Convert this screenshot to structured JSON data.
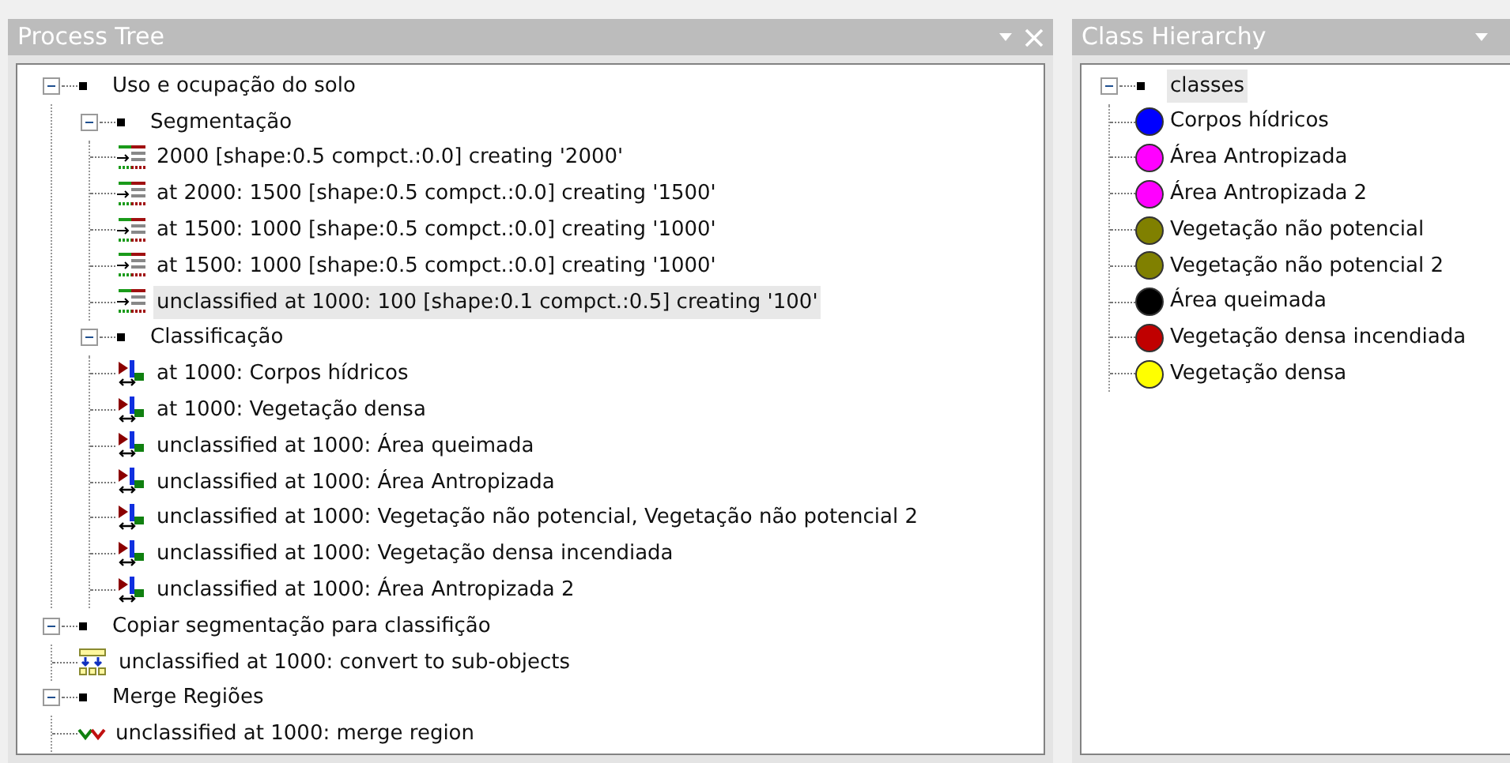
{
  "process_tree": {
    "title": "Process Tree",
    "items": [
      {
        "kind": "process",
        "label": "Uso e ocupação do solo",
        "expanded": true,
        "selected": false,
        "children": [
          {
            "kind": "process",
            "label": "Segmentação",
            "expanded": true,
            "selected": false,
            "children": [
              {
                "kind": "segmentation",
                "label": "2000 [shape:0.5 compct.:0.0] creating '2000'",
                "selected": false
              },
              {
                "kind": "segmentation",
                "label": "at  2000: 1500 [shape:0.5 compct.:0.0] creating '1500'",
                "selected": false
              },
              {
                "kind": "segmentation",
                "label": "at  1500: 1000 [shape:0.5 compct.:0.0] creating '1000'",
                "selected": false
              },
              {
                "kind": "segmentation",
                "label": "at  1500: 1000 [shape:0.5 compct.:0.0] creating '1000'",
                "selected": false
              },
              {
                "kind": "segmentation",
                "label": "unclassified at  1000: 100 [shape:0.1 compct.:0.5] creating '100'",
                "selected": true
              }
            ]
          },
          {
            "kind": "process",
            "label": "Classificação",
            "expanded": true,
            "selected": false,
            "children": [
              {
                "kind": "classification",
                "label": "at  1000: Corpos hídricos",
                "selected": false
              },
              {
                "kind": "classification",
                "label": "at  1000: Vegetação densa",
                "selected": false
              },
              {
                "kind": "classification",
                "label": "unclassified at  1000: Área queimada",
                "selected": false
              },
              {
                "kind": "classification",
                "label": "unclassified at  1000: Área Antropizada",
                "selected": false
              },
              {
                "kind": "classification",
                "label": "unclassified at  1000: Vegetação não potencial, Vegetação não potencial 2",
                "selected": false
              },
              {
                "kind": "classification",
                "label": "unclassified at  1000: Vegetação densa incendiada",
                "selected": false
              },
              {
                "kind": "classification",
                "label": "unclassified at  1000: Área Antropizada 2",
                "selected": false
              }
            ]
          }
        ]
      },
      {
        "kind": "process",
        "label": "Copiar segmentação para classifição",
        "expanded": true,
        "selected": false,
        "children": [
          {
            "kind": "convert",
            "label": "unclassified at  1000: convert to sub-objects",
            "selected": false
          }
        ]
      },
      {
        "kind": "process",
        "label": "Merge Regiões",
        "expanded": true,
        "selected": false,
        "children": [
          {
            "kind": "merge",
            "label": "unclassified at  1000: merge region",
            "selected": false
          }
        ]
      }
    ]
  },
  "class_hierarchy": {
    "title": "Class Hierarchy",
    "root": {
      "label": "classes",
      "expanded": true,
      "selected": true
    },
    "classes": [
      {
        "label": "Corpos hídricos",
        "color": "#0000ff"
      },
      {
        "label": "Área Antropizada",
        "color": "#ff00ff"
      },
      {
        "label": "Área Antropizada 2",
        "color": "#ff00ff"
      },
      {
        "label": "Vegetação não potencial",
        "color": "#808000"
      },
      {
        "label": "Vegetação não potencial 2",
        "color": "#808000"
      },
      {
        "label": "Área queimada",
        "color": "#000000"
      },
      {
        "label": "Vegetação densa incendiada",
        "color": "#c00000"
      },
      {
        "label": "Vegetação densa",
        "color": "#ffff00"
      }
    ]
  }
}
